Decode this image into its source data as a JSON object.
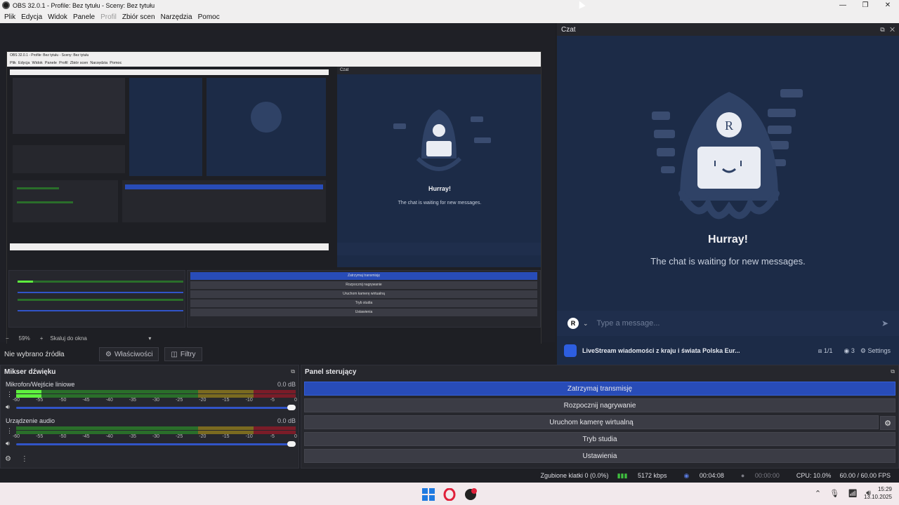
{
  "window": {
    "title": "OBS 32.0.1 - Profile: Bez tytułu - Sceny: Bez tytułu",
    "controls": [
      "—",
      "❐",
      "✕"
    ]
  },
  "menu": {
    "items": [
      "Plik",
      "Edycja",
      "Widok",
      "Panele",
      "Profil",
      "Zbiór scen",
      "Narzędzia",
      "Pomoc"
    ]
  },
  "preview": {
    "zoom": "59%",
    "scale_mode": "Skaluj do okna",
    "zoom_minus": "−",
    "zoom_plus": "+"
  },
  "sources": {
    "no_source": "Nie wybrano źródła",
    "properties": "Właściwości",
    "filters": "Filtry"
  },
  "chat": {
    "dock_title": "Czat",
    "headline": "Hurray!",
    "message": "The chat is waiting for new messages.",
    "avatar_letter": "R",
    "input_placeholder": "Type a message...",
    "channel_name": "LiveStream wiadomości z kraju i świata Polska Eur...",
    "viewers_ratio": "1/1",
    "viewers": "3",
    "settings": "Settings"
  },
  "mixer": {
    "title": "Mikser dźwięku",
    "channels": [
      {
        "name": "Mikrofon/Wejście liniowe",
        "db": "0.0 dB",
        "level": 0.09
      },
      {
        "name": "Urządzenie audio",
        "db": "0.0 dB",
        "level": 0
      }
    ],
    "ticks": [
      "-60",
      "-55",
      "-50",
      "-45",
      "-40",
      "-35",
      "-30",
      "-25",
      "-20",
      "-15",
      "-10",
      "-5",
      "0"
    ]
  },
  "controls": {
    "title": "Panel sterujący",
    "stop_stream": "Zatrzymaj transmisję",
    "start_recording": "Rozpocznij nagrywanie",
    "virtual_camera": "Uruchom kamerę wirtualną",
    "studio_mode": "Tryb studia",
    "settings": "Ustawienia"
  },
  "status": {
    "dropped": "Zgubione klatki 0 (0.0%)",
    "bitrate": "5172 kbps",
    "stream_time": "00:04:08",
    "rec_time": "00:00:00",
    "cpu": "CPU: 10.0%",
    "fps": "60.00 / 60.00 FPS"
  },
  "taskbar": {
    "time": "15:29",
    "date": "13.10.2025"
  },
  "colors": {
    "accent_blue": "#284cb8",
    "chat_bg": "#1c2b47",
    "meter_green": "#5ef03e"
  }
}
